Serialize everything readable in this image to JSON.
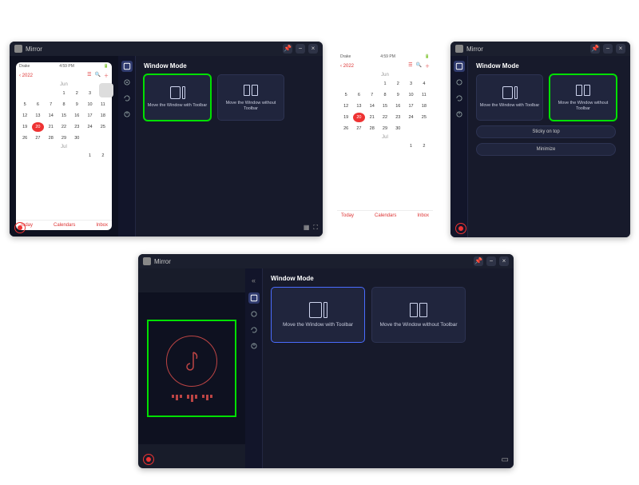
{
  "title": "Mirror",
  "windowMode": {
    "heading": "Window Mode",
    "card_with_toolbar": "Move the Window\nwith Toolbar",
    "card_without_toolbar": "Move the Window\nwithout Toolbar"
  },
  "buttons": {
    "sticky": "Sticky on top",
    "minimize": "Minimize"
  },
  "phone": {
    "carrier": "Drake",
    "time": "4:59 PM",
    "back": "2022",
    "month1": "Jun",
    "month2": "Jul",
    "today": "Today",
    "calendars": "Calendars",
    "inbox": "Inbox",
    "days_jun_row1": [
      "",
      "",
      "",
      "1",
      "2",
      "3",
      "4"
    ],
    "days_jun_row2": [
      "5",
      "6",
      "7",
      "8",
      "9",
      "10",
      "11"
    ],
    "days_jun_row3": [
      "12",
      "13",
      "14",
      "15",
      "16",
      "17",
      "18"
    ],
    "days_jun_row4": [
      "19",
      "20",
      "21",
      "22",
      "23",
      "24",
      "25"
    ],
    "days_jun_row5": [
      "26",
      "27",
      "28",
      "29",
      "30",
      "",
      ""
    ],
    "days_jul_row1": [
      "",
      "",
      "",
      "",
      "",
      "1",
      "2"
    ],
    "today_date": "20"
  },
  "win_controls": {
    "pin": "📌",
    "min": "−",
    "close": "×"
  }
}
